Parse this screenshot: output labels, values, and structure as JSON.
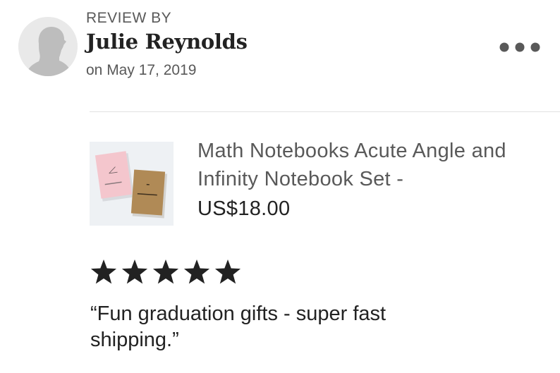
{
  "review": {
    "header_label": "REVIEW BY",
    "reviewer_name": "Julie Reynolds",
    "date_text": "on May 17, 2019",
    "rating": 5,
    "rating_max": 5,
    "text": "“Fun graduation gifts - super fast shipping.”"
  },
  "product": {
    "title": "Math Notebooks Acute Angle and Infinity Notebook Set -",
    "price": "US$18.00"
  },
  "icons": {
    "avatar": "default-user-silhouette-icon",
    "more": "more-options-icon",
    "star": "star-icon"
  },
  "colors": {
    "primary_text": "#222222",
    "secondary_text": "#595959",
    "star": "#222222",
    "divider": "#e1e1e1",
    "avatar_bg": "#e9e9e9"
  }
}
